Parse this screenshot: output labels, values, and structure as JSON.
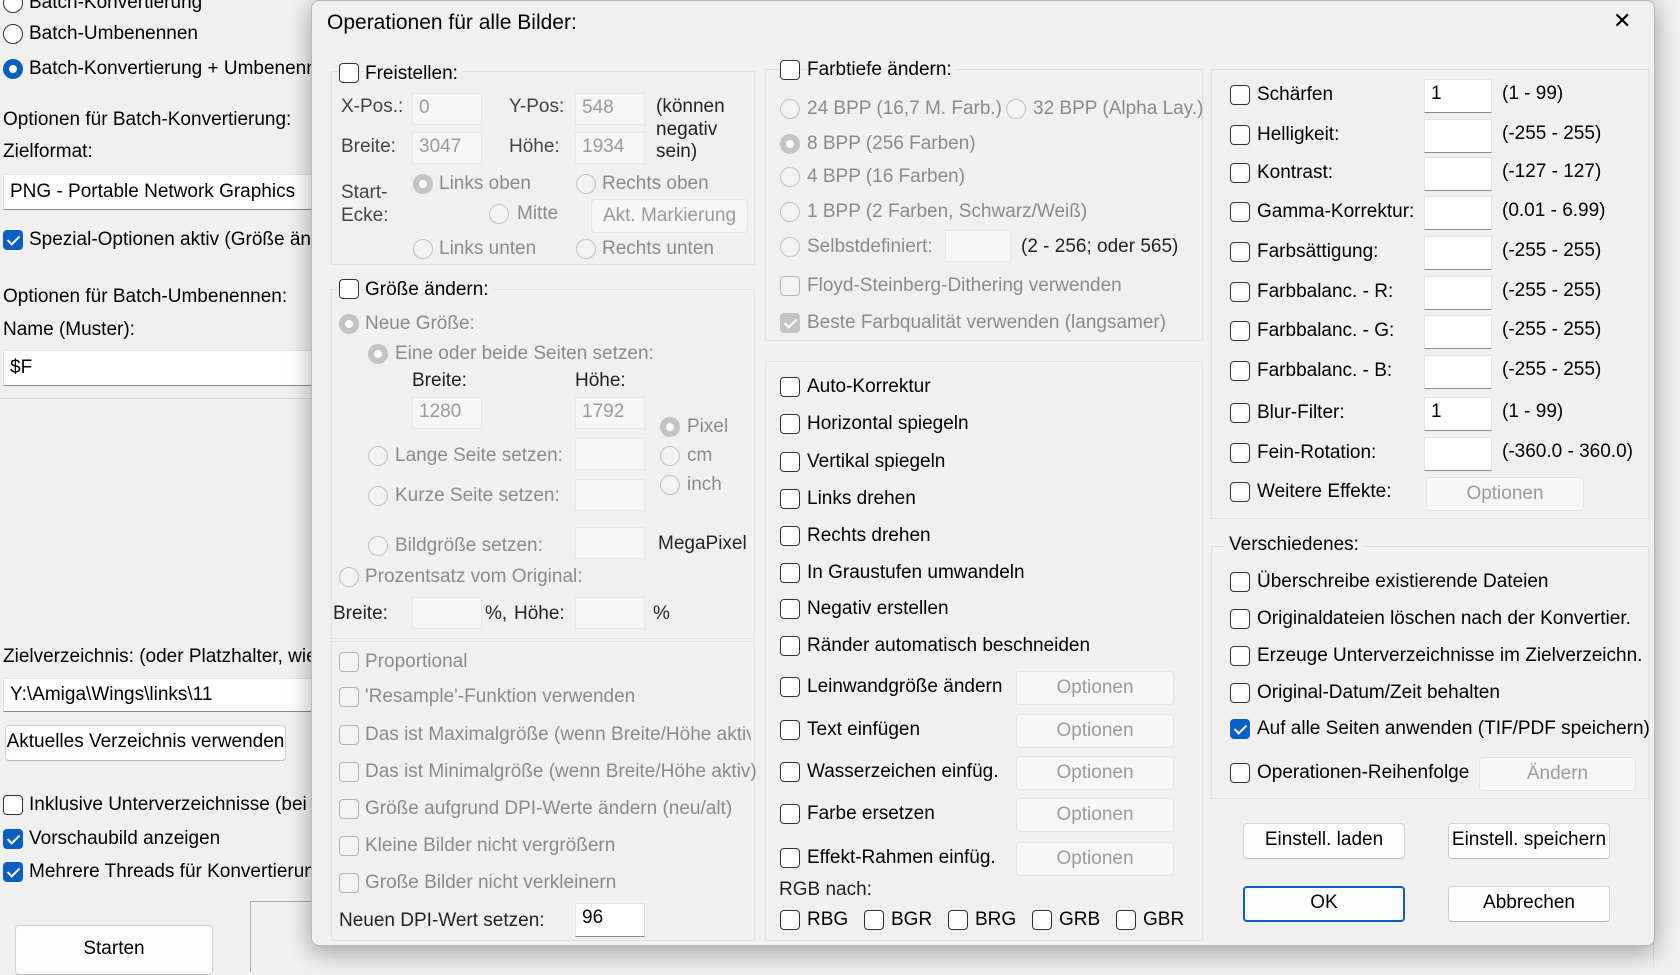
{
  "background_window": {
    "radio_batch_convert": "Batch-Konvertierung",
    "radio_batch_rename": "Batch-Umbenennen",
    "radio_batch_both": "Batch-Konvertierung + Umbenenn",
    "opt_convert_label": "Optionen für Batch-Konvertierung:",
    "target_format_label": "Zielformat:",
    "target_format_value": "PNG - Portable Network Graphics",
    "special_options": "Spezial-Optionen aktiv (Größe änd",
    "opt_rename_label": "Optionen für Batch-Umbenennen:",
    "name_pattern_label": "Name (Muster):",
    "name_pattern_value": "$F",
    "target_dir_label": "Zielverzeichnis: (oder Platzhalter, wie:",
    "target_dir_value": "Y:\\Amiga\\Wings\\links\\11",
    "use_current_dir": "Aktuelles Verzeichnis verwenden",
    "include_subdirs": "Inklusive Unterverzeichnisse (bei '",
    "show_preview": "Vorschaubild anzeigen",
    "multi_threads": "Mehrere Threads für Konvertierung",
    "start_button": "Starten"
  },
  "dialog": {
    "title": "Operationen für alle Bilder:",
    "close_glyph": "✕",
    "crop": {
      "label": "Freistellen:",
      "xpos_label": "X-Pos.:",
      "xpos_value": "0",
      "ypos_label": "Y-Pos:",
      "ypos_value": "548",
      "note": "(können negativ sein)",
      "note_l1": "(können",
      "note_l2": "negativ",
      "note_l3": "sein)",
      "width_label": "Breite:",
      "width_value": "3047",
      "height_label": "Höhe:",
      "height_value": "1934",
      "corner_label_l1": "Start-",
      "corner_label_l2": "Ecke:",
      "top_left": "Links oben",
      "top_right": "Rechts oben",
      "center": "Mitte",
      "current_marking": "Akt. Markierung",
      "bottom_left": "Links unten",
      "bottom_right": "Rechts unten"
    },
    "resize": {
      "label": "Größe ändern:",
      "new_size": "Neue Größe:",
      "set_sides": "Eine oder beide Seiten setzen:",
      "width_label": "Breite:",
      "height_label": "Höhe:",
      "width_value": "1280",
      "height_value": "1792",
      "long_side": "Lange Seite setzen:",
      "short_side": "Kurze Seite setzen:",
      "unit_pixel": "Pixel",
      "unit_cm": "cm",
      "unit_inch": "inch",
      "image_size": "Bildgröße setzen:",
      "megapixel": "MegaPixel",
      "percent": "Prozentsatz vom Original:",
      "pct_width": "Breite:",
      "pct_height": "Höhe:",
      "pct_sign": "%",
      "pct_sign_comma": "%,"
    },
    "resize_options": {
      "proportional": "Proportional",
      "resample": "'Resample'-Funktion verwenden",
      "max_size": "Das ist Maximalgröße (wenn Breite/Höhe aktiv)",
      "min_size": "Das ist Minimalgröße (wenn Breite/Höhe aktiv)",
      "dpi_resize": "Größe aufgrund DPI-Werte ändern (neu/alt)",
      "no_enlarge": "Kleine Bilder nicht vergrößern",
      "no_shrink": "Große Bilder nicht verkleinern",
      "dpi_label": "Neuen DPI-Wert setzen:",
      "dpi_value": "96"
    },
    "color_depth": {
      "label": "Farbtiefe ändern:",
      "bpp24": "24 BPP (16,7 M. Farb.)",
      "bpp32": "32 BPP (Alpha Lay.)",
      "bpp8": "8 BPP (256 Farben)",
      "bpp4": "4 BPP (16 Farben)",
      "bpp1": "1 BPP (2 Farben, Schwarz/Weiß)",
      "custom": "Selbstdefiniert:",
      "custom_range": "(2 - 256; oder 565)",
      "dithering": "Floyd-Steinberg-Dithering verwenden",
      "best_quality": "Beste Farbqualität verwenden (langsamer)"
    },
    "transforms": {
      "auto_correct": "Auto-Korrektur",
      "flip_h": "Horizontal spiegeln",
      "flip_v": "Vertikal spiegeln",
      "rotate_left": "Links drehen",
      "rotate_right": "Rechts drehen",
      "grayscale": "In Graustufen umwandeln",
      "negative": "Negativ erstellen",
      "auto_crop": "Ränder automatisch beschneiden",
      "canvas": "Leinwandgröße ändern",
      "insert_text": "Text einfügen",
      "watermark": "Wasserzeichen einfüg.",
      "replace_color": "Farbe ersetzen",
      "effect_frame": "Effekt-Rahmen einfüg.",
      "options": "Optionen",
      "rgb_label": "RGB nach:",
      "rgb": [
        "RBG",
        "BGR",
        "BRG",
        "GRB",
        "GBR"
      ]
    },
    "adjustments": [
      {
        "label": "Schärfen",
        "value": "1",
        "range": "(1  -  99)"
      },
      {
        "label": "Helligkeit:",
        "value": "",
        "range": "(-255  -  255)"
      },
      {
        "label": "Kontrast:",
        "value": "",
        "range": "(-127  -  127)"
      },
      {
        "label": "Gamma-Korrektur:",
        "value": "",
        "range": "(0.01  -  6.99)"
      },
      {
        "label": "Farbsättigung:",
        "value": "",
        "range": "(-255  -  255)"
      },
      {
        "label": "Farbbalanc. - R:",
        "value": "",
        "range": "(-255  -  255)"
      },
      {
        "label": "Farbbalanc. - G:",
        "value": "",
        "range": "(-255  -  255)"
      },
      {
        "label": "Farbbalanc. - B:",
        "value": "",
        "range": "(-255  -  255)"
      },
      {
        "label": "Blur-Filter:",
        "value": "1",
        "range": "(1  -  99)"
      },
      {
        "label": "Fein-Rotation:",
        "value": "",
        "range": "(-360.0  -  360.0)"
      }
    ],
    "more_effects": "Weitere Effekte:",
    "more_effects_button": "Optionen",
    "misc": {
      "label": "Verschiedenes:",
      "overwrite": "Überschreibe existierende Dateien",
      "delete_originals": "Originaldateien löschen nach der Konvertier.",
      "create_subdirs": "Erzeuge Unterverzeichnisse im Zielverzeichn.",
      "keep_date": "Original-Datum/Zeit behalten",
      "all_pages": "Auf alle Seiten anwenden (TIF/PDF speichern)",
      "op_order": "Operationen-Reihenfolge",
      "change_button": "Ändern"
    },
    "buttons": {
      "load": "Einstell. laden",
      "save": "Einstell. speichern",
      "ok": "OK",
      "cancel": "Abbrechen"
    }
  },
  "colors": {
    "accent": "#0a5fc2",
    "disabled_text": "#8a8a8a",
    "window_bg": "#f0f0f0"
  }
}
